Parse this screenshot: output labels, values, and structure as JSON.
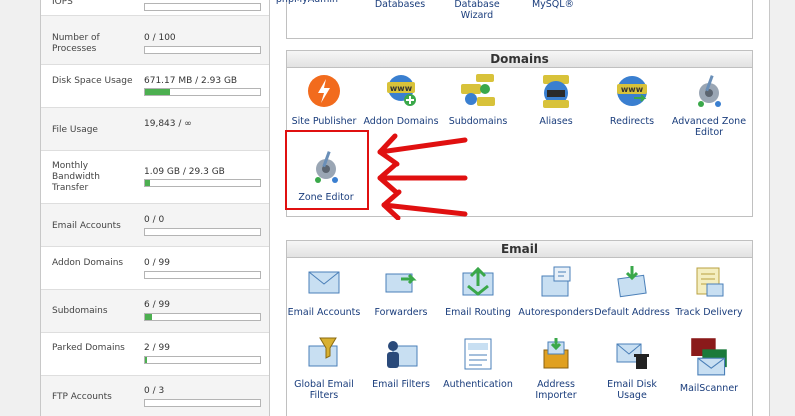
{
  "stats": [
    {
      "label": "IOPS",
      "value": "",
      "fill": 0
    },
    {
      "label": "Number of Processes",
      "value": "0 / 100",
      "fill": 0
    },
    {
      "label": "Disk Space Usage",
      "value": "671.17 MB / 2.93 GB",
      "fill": 0.22
    },
    {
      "label": "File Usage",
      "value": "19,843 / ∞",
      "fill": null
    },
    {
      "label": "Monthly Bandwidth Transfer",
      "value": "1.09 GB / 29.3 GB",
      "fill": 0.04
    },
    {
      "label": "Email Accounts",
      "value": "0 / 0",
      "fill": 0
    },
    {
      "label": "Addon Domains",
      "value": "0 / 99",
      "fill": 0
    },
    {
      "label": "Subdomains",
      "value": "6 / 99",
      "fill": 0.06
    },
    {
      "label": "Parked Domains",
      "value": "2 / 99",
      "fill": 0.02
    },
    {
      "label": "FTP Accounts",
      "value": "0 / 3",
      "fill": 0
    }
  ],
  "top_items": [
    "phpMyAdmin",
    "Databases",
    "Database Wizard",
    "MySQL®"
  ],
  "domains": {
    "title": "Domains",
    "items": [
      {
        "label": "Site Publisher",
        "icon": "site-publisher-icon"
      },
      {
        "label": "Addon Domains",
        "icon": "addon-domains-icon"
      },
      {
        "label": "Subdomains",
        "icon": "subdomains-icon"
      },
      {
        "label": "Aliases",
        "icon": "aliases-icon"
      },
      {
        "label": "Redirects",
        "icon": "redirects-icon"
      },
      {
        "label": "Advanced Zone Editor",
        "icon": "advanced-zone-editor-icon"
      },
      {
        "label": "Zone Editor",
        "icon": "zone-editor-icon"
      }
    ]
  },
  "email": {
    "title": "Email",
    "items": [
      {
        "label": "Email Accounts",
        "icon": "email-accounts-icon"
      },
      {
        "label": "Forwarders",
        "icon": "forwarders-icon"
      },
      {
        "label": "Email Routing",
        "icon": "email-routing-icon"
      },
      {
        "label": "Autoresponders",
        "icon": "autoresponders-icon"
      },
      {
        "label": "Default Address",
        "icon": "default-address-icon"
      },
      {
        "label": "Track Delivery",
        "icon": "track-delivery-icon"
      },
      {
        "label": "Global Email Filters",
        "icon": "global-email-filters-icon"
      },
      {
        "label": "Email Filters",
        "icon": "email-filters-icon"
      },
      {
        "label": "Authentication",
        "icon": "authentication-icon"
      },
      {
        "label": "Address Importer",
        "icon": "address-importer-icon"
      },
      {
        "label": "Email Disk Usage",
        "icon": "email-disk-usage-icon"
      },
      {
        "label": "MailScanner",
        "icon": "mailscanner-icon"
      }
    ]
  },
  "colors": {
    "accent_red": "#e01010",
    "bar_green": "#4caf50",
    "link_blue": "#1a3d7c"
  }
}
